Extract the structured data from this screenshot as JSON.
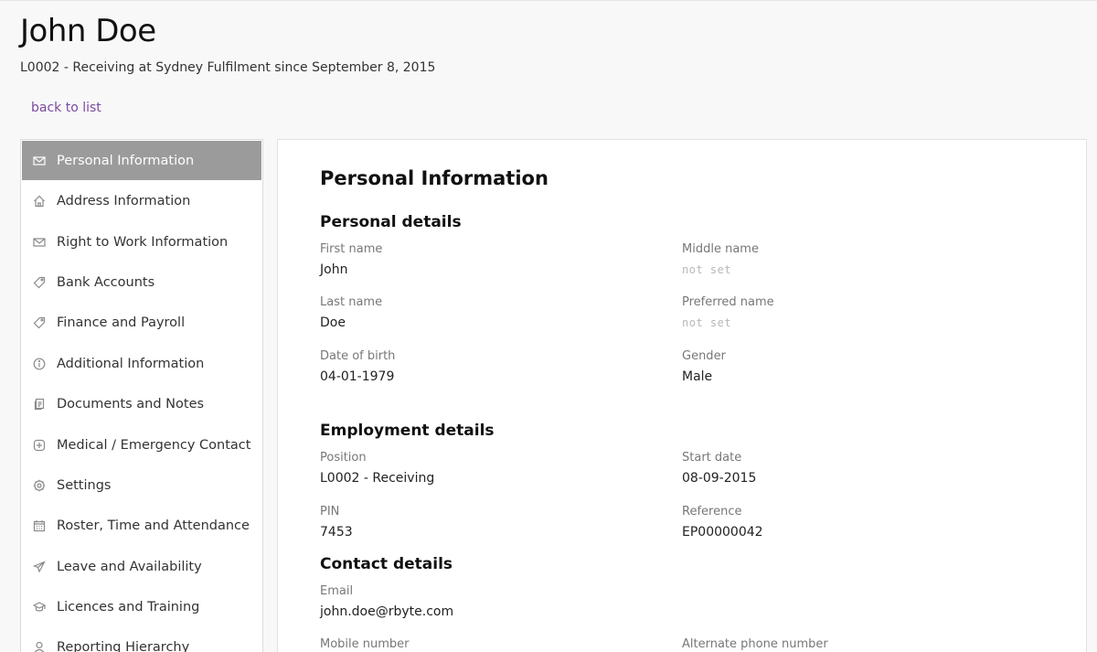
{
  "header": {
    "title": "John Doe",
    "subtitle": "L0002 - Receiving at Sydney Fulfilment since September 8, 2015",
    "back_link": "back to list"
  },
  "sidebar": {
    "items": [
      {
        "label": "Personal Information",
        "icon": "envelope-icon",
        "active": true
      },
      {
        "label": "Address Information",
        "icon": "home-icon"
      },
      {
        "label": "Right to Work Information",
        "icon": "envelope-icon"
      },
      {
        "label": "Bank Accounts",
        "icon": "tag-icon"
      },
      {
        "label": "Finance and Payroll",
        "icon": "tag-icon"
      },
      {
        "label": "Additional Information",
        "icon": "info-icon"
      },
      {
        "label": "Documents and Notes",
        "icon": "documents-icon"
      },
      {
        "label": "Medical / Emergency Contact",
        "icon": "medical-icon"
      },
      {
        "label": "Settings",
        "icon": "gear-icon"
      },
      {
        "label": "Roster, Time and Attendance",
        "icon": "calendar-icon"
      },
      {
        "label": "Leave and Availability",
        "icon": "plane-icon"
      },
      {
        "label": "Licences and Training",
        "icon": "graduation-cap-icon"
      },
      {
        "label": "Reporting Hierarchy",
        "icon": "person-icon"
      }
    ]
  },
  "main": {
    "title": "Personal Information",
    "personal": {
      "title": "Personal details",
      "first_name": {
        "label": "First name",
        "value": "John"
      },
      "middle_name": {
        "label": "Middle name",
        "value": "not set"
      },
      "last_name": {
        "label": "Last name",
        "value": "Doe"
      },
      "preferred_name": {
        "label": "Preferred name",
        "value": "not set"
      },
      "dob": {
        "label": "Date of birth",
        "value": "04-01-1979"
      },
      "gender": {
        "label": "Gender",
        "value": "Male"
      }
    },
    "employment": {
      "title": "Employment details",
      "position": {
        "label": "Position",
        "value": "L0002 - Receiving"
      },
      "start_date": {
        "label": "Start date",
        "value": "08-09-2015"
      },
      "pin": {
        "label": "PIN",
        "value": "7453"
      },
      "reference": {
        "label": "Reference",
        "value": "EP00000042"
      }
    },
    "contact": {
      "title": "Contact details",
      "email": {
        "label": "Email",
        "value": "john.doe@rbyte.com"
      },
      "mobile": {
        "label": "Mobile number"
      },
      "alt_phone": {
        "label": "Alternate phone number"
      }
    }
  },
  "colors": {
    "accent_link": "#7b4a9e",
    "active_nav": "#9b9b9b"
  }
}
